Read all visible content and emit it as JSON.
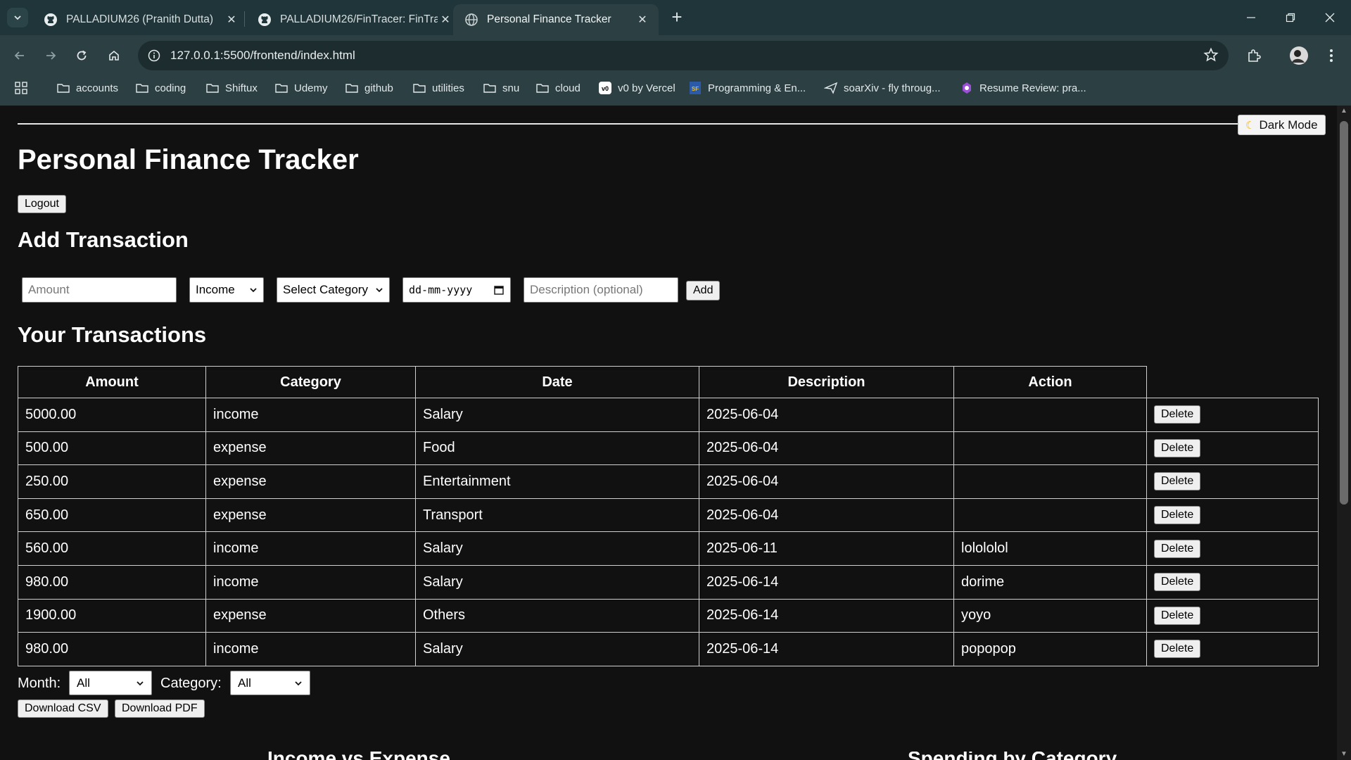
{
  "browser": {
    "tabs": [
      {
        "title": "PALLADIUM26 (Pranith Dutta)",
        "icon": "github-icon",
        "active": false
      },
      {
        "title": "PALLADIUM26/FinTracer: FinTra",
        "icon": "github-icon",
        "active": false
      },
      {
        "title": "Personal Finance Tracker",
        "icon": "globe-icon",
        "active": true
      }
    ],
    "url": "127.0.0.1:5500/frontend/index.html",
    "bookmarks": [
      {
        "label": "accounts",
        "icon": "folder-icon"
      },
      {
        "label": "coding",
        "icon": "folder-icon"
      },
      {
        "label": "Shiftux",
        "icon": "folder-icon"
      },
      {
        "label": "Udemy",
        "icon": "folder-icon"
      },
      {
        "label": "github",
        "icon": "folder-icon"
      },
      {
        "label": "utilities",
        "icon": "folder-icon"
      },
      {
        "label": "snu",
        "icon": "folder-icon"
      },
      {
        "label": "cloud",
        "icon": "folder-icon"
      },
      {
        "label": "v0 by Vercel",
        "icon": "v0-icon"
      },
      {
        "label": "Programming & En...",
        "icon": "sf-icon"
      },
      {
        "label": "soarXiv - fly throug...",
        "icon": "paper-plane-icon"
      },
      {
        "label": "Resume Review: pra...",
        "icon": "ai-icon"
      }
    ]
  },
  "page": {
    "dark_mode_label": "Dark Mode",
    "title": "Personal Finance Tracker",
    "logout_label": "Logout",
    "add_heading": "Add Transaction",
    "form": {
      "amount_placeholder": "Amount",
      "type_value": "Income",
      "category_value": "Select Category",
      "date_placeholder": "dd-mm-yyyy",
      "description_placeholder": "Description (optional)",
      "add_label": "Add"
    },
    "transactions_heading": "Your Transactions",
    "table": {
      "headers": [
        "Amount",
        "Category",
        "Date",
        "Description",
        "Action"
      ],
      "rows": [
        {
          "c1": "5000.00",
          "c2": "income",
          "c3": "Salary",
          "c4": "2025-06-04",
          "c5": "",
          "action": "Delete"
        },
        {
          "c1": "500.00",
          "c2": "expense",
          "c3": "Food",
          "c4": "2025-06-04",
          "c5": "",
          "action": "Delete"
        },
        {
          "c1": "250.00",
          "c2": "expense",
          "c3": "Entertainment",
          "c4": "2025-06-04",
          "c5": "",
          "action": "Delete"
        },
        {
          "c1": "650.00",
          "c2": "expense",
          "c3": "Transport",
          "c4": "2025-06-04",
          "c5": "",
          "action": "Delete"
        },
        {
          "c1": "560.00",
          "c2": "income",
          "c3": "Salary",
          "c4": "2025-06-11",
          "c5": "lolololol",
          "action": "Delete"
        },
        {
          "c1": "980.00",
          "c2": "income",
          "c3": "Salary",
          "c4": "2025-06-14",
          "c5": "dorime",
          "action": "Delete"
        },
        {
          "c1": "1900.00",
          "c2": "expense",
          "c3": "Others",
          "c4": "2025-06-14",
          "c5": "yoyo",
          "action": "Delete"
        },
        {
          "c1": "980.00",
          "c2": "income",
          "c3": "Salary",
          "c4": "2025-06-14",
          "c5": "popopop",
          "action": "Delete"
        }
      ]
    },
    "filters": {
      "month_label": "Month:",
      "month_value": "All",
      "category_label": "Category:",
      "category_value": "All"
    },
    "download_csv_label": "Download CSV",
    "download_pdf_label": "Download PDF",
    "cut_off_heading_left": "Income vs Expense",
    "cut_off_heading_right": "Spending by Category"
  }
}
